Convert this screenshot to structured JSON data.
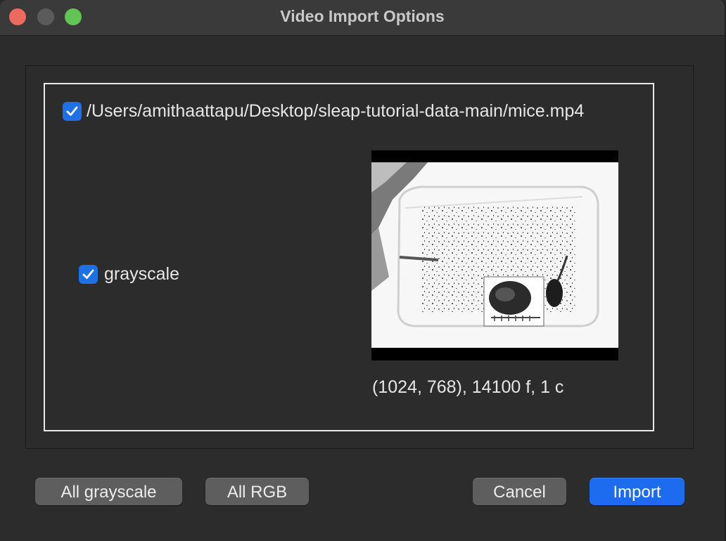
{
  "window": {
    "title": "Video Import Options"
  },
  "video": {
    "path": "/Users/amithaattapu/Desktop/sleap-tutorial-data-main/mice.mp4",
    "selected": true,
    "grayscale_label": "grayscale",
    "grayscale_checked": true,
    "info": "(1024, 768), 14100 f, 1 c"
  },
  "buttons": {
    "all_grayscale": "All grayscale",
    "all_rgb": "All RGB",
    "cancel": "Cancel",
    "import": "Import"
  },
  "colors": {
    "accent": "#1d6cf0",
    "close": "#ed6a5e",
    "zoom": "#61c454"
  }
}
